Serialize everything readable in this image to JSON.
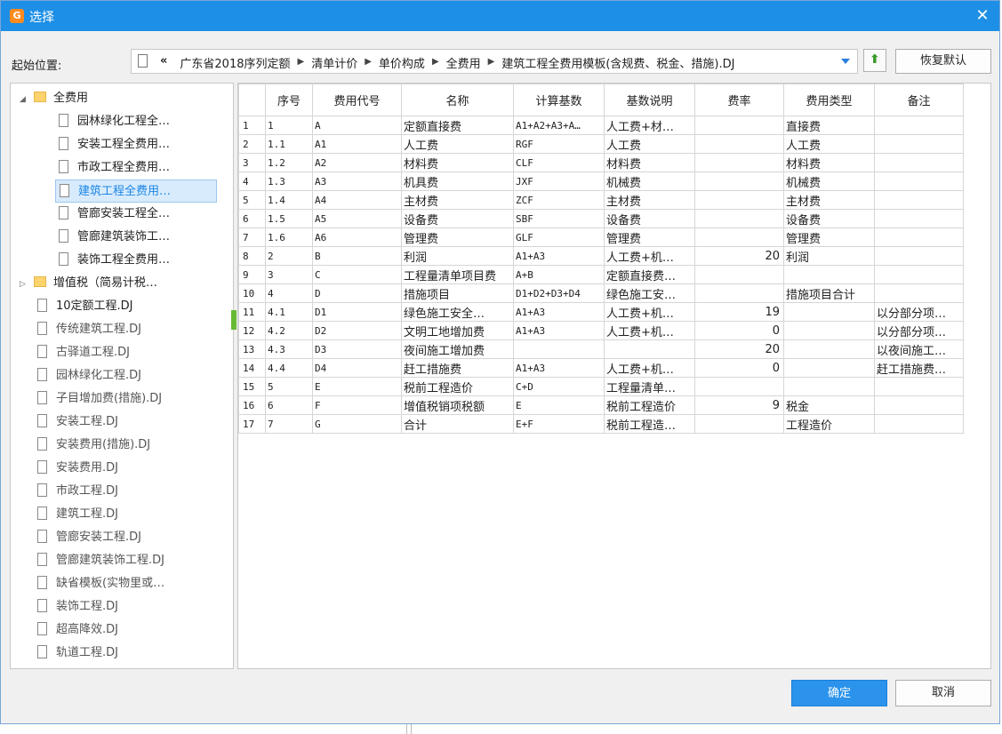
{
  "window": {
    "title": "选择",
    "close_glyph": "✕"
  },
  "path": {
    "label": "起始位置:",
    "back": "«",
    "crumbs": [
      "广东省2018序列定额",
      "清单计价",
      "单价构成",
      "全费用",
      "建筑工程全费用模板(含规费、税金、措施).DJ"
    ],
    "restore_label": "恢复默认"
  },
  "tree": {
    "root_folder": "全费用",
    "root_children": [
      "园林绿化工程全…",
      "安装工程全费用…",
      "市政工程全费用…",
      "建筑工程全费用…",
      "管廊安装工程全…",
      "管廊建筑装饰工…",
      "装饰工程全费用…"
    ],
    "selected_index": 3,
    "second_folder": "增值税（简易计税…",
    "files": [
      "10定额工程.DJ",
      "传统建筑工程.DJ",
      "古驿道工程.DJ",
      "园林绿化工程.DJ",
      "子目增加费(措施).DJ",
      "安装工程.DJ",
      "安装费用(措施).DJ",
      "安装费用.DJ",
      "市政工程.DJ",
      "建筑工程.DJ",
      "管廊安装工程.DJ",
      "管廊建筑装饰工程.DJ",
      "缺省模板(实物里或…",
      "装饰工程.DJ",
      "超高降效.DJ",
      "轨道工程.DJ"
    ]
  },
  "table": {
    "headers": [
      "",
      "序号",
      "费用代号",
      "名称",
      "计算基数",
      "基数说明",
      "费率",
      "费用类型",
      "备注"
    ],
    "rows": [
      [
        "1",
        "1",
        "A",
        "定额直接费",
        "A1+A2+A3+A…",
        "人工费+材…",
        "",
        "直接费",
        ""
      ],
      [
        "2",
        "1.1",
        "A1",
        "人工费",
        "RGF",
        "人工费",
        "",
        "人工费",
        ""
      ],
      [
        "3",
        "1.2",
        "A2",
        "材料费",
        "CLF",
        "材料费",
        "",
        "材料费",
        ""
      ],
      [
        "4",
        "1.3",
        "A3",
        "机具费",
        "JXF",
        "机械费",
        "",
        "机械费",
        ""
      ],
      [
        "5",
        "1.4",
        "A4",
        "主材费",
        "ZCF",
        "主材费",
        "",
        "主材费",
        ""
      ],
      [
        "6",
        "1.5",
        "A5",
        "设备费",
        "SBF",
        "设备费",
        "",
        "设备费",
        ""
      ],
      [
        "7",
        "1.6",
        "A6",
        "管理费",
        "GLF",
        "管理费",
        "",
        "管理费",
        ""
      ],
      [
        "8",
        "2",
        "B",
        "利润",
        "A1+A3",
        "人工费+机…",
        "20",
        "利润",
        ""
      ],
      [
        "9",
        "3",
        "C",
        "工程量清单项目费",
        "A+B",
        "定额直接费…",
        "",
        "",
        ""
      ],
      [
        "10",
        "4",
        "D",
        "措施项目",
        "D1+D2+D3+D4",
        "绿色施工安…",
        "",
        "措施项目合计",
        ""
      ],
      [
        "11",
        "4.1",
        "D1",
        "绿色施工安全…",
        "A1+A3",
        "人工费+机…",
        "19",
        "",
        "以分部分项…"
      ],
      [
        "12",
        "4.2",
        "D2",
        "文明工地增加费",
        "A1+A3",
        "人工费+机…",
        "0",
        "",
        "以分部分项…"
      ],
      [
        "13",
        "4.3",
        "D3",
        "夜间施工增加费",
        "",
        "",
        "20",
        "",
        "以夜间施工…"
      ],
      [
        "14",
        "4.4",
        "D4",
        "赶工措施费",
        "A1+A3",
        "人工费+机…",
        "0",
        "",
        "赶工措施费…"
      ],
      [
        "15",
        "5",
        "E",
        "税前工程造价",
        "C+D",
        "工程量清单…",
        "",
        "",
        ""
      ],
      [
        "16",
        "6",
        "F",
        "增值税销项税额",
        "E",
        "税前工程造价",
        "9",
        "税金",
        ""
      ],
      [
        "17",
        "7",
        "G",
        "合计",
        "E+F",
        "税前工程造…",
        "",
        "工程造价",
        ""
      ]
    ]
  },
  "buttons": {
    "ok": "确定",
    "cancel": "取消"
  },
  "colors": {
    "title_bar": "#1e8fe6",
    "ok_button": "#2b93ec",
    "selection": "#1c86e8"
  }
}
